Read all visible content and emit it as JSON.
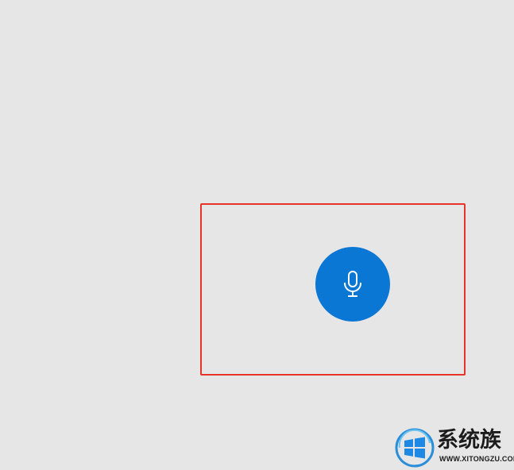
{
  "voice_panel": {
    "mic_button_icon": "microphone-icon",
    "accent_color": "#0a77d4",
    "highlight_color": "#e8332b"
  },
  "watermark": {
    "title": "系统族",
    "url": "WWW.XITONGZU.COM",
    "logo_icon": "windows-logo-icon"
  }
}
